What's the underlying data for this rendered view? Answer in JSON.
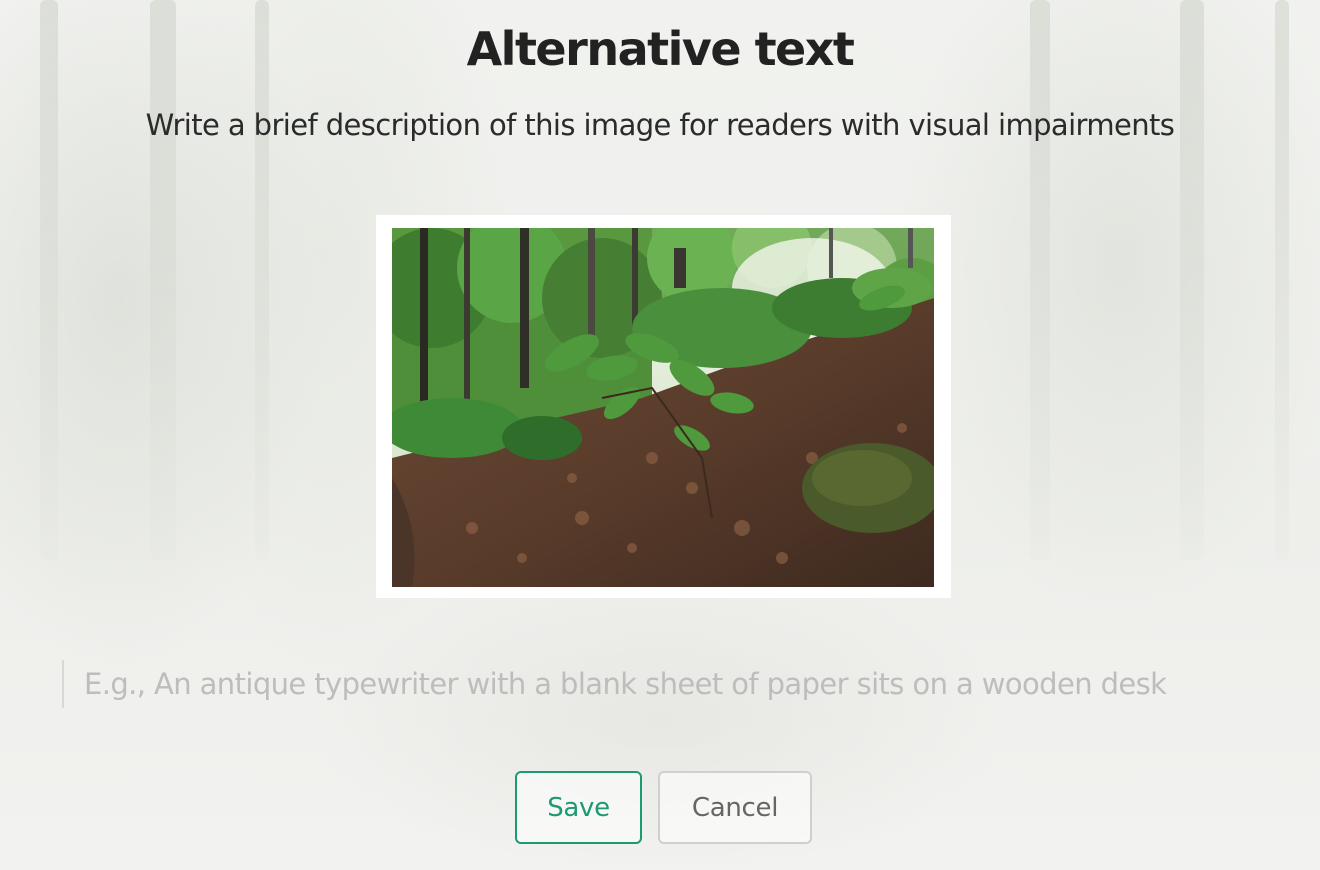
{
  "dialog": {
    "title": "Alternative text",
    "subtitle": "Write a brief description of this image for readers with visual impairments"
  },
  "alt_text_field": {
    "value": "",
    "placeholder": "E.g., An antique typewriter with a blank sheet of paper sits on a wooden desk"
  },
  "actions": {
    "save_label": "Save",
    "cancel_label": "Cancel"
  },
  "colors": {
    "accent": "#1c9a73",
    "title_text": "#222222",
    "placeholder_text": "#bdbdbd",
    "cancel_border": "#cfcfcf",
    "background": "#f3f3f1"
  }
}
